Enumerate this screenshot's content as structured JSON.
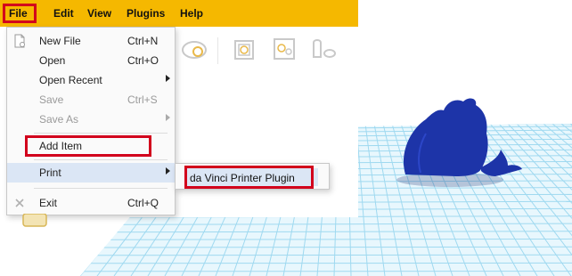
{
  "menubar": {
    "items": [
      {
        "label": "File"
      },
      {
        "label": "Edit"
      },
      {
        "label": "View"
      },
      {
        "label": "Plugins"
      },
      {
        "label": "Help"
      }
    ]
  },
  "file_menu": {
    "items": [
      {
        "label": "New File",
        "shortcut": "Ctrl+N",
        "enabled": true,
        "icon": "new-file-icon"
      },
      {
        "label": "Open",
        "shortcut": "Ctrl+O",
        "enabled": true
      },
      {
        "label": "Open Recent",
        "shortcut": "",
        "enabled": true,
        "submenu": true
      },
      {
        "label": "Save",
        "shortcut": "Ctrl+S",
        "enabled": false
      },
      {
        "label": "Save As",
        "shortcut": "",
        "enabled": false,
        "submenu": true
      },
      {
        "label": "Add Item",
        "shortcut": "",
        "enabled": true
      },
      {
        "label": "Print",
        "shortcut": "",
        "enabled": true,
        "submenu": true,
        "selected": true
      },
      {
        "label": "Exit",
        "shortcut": "Ctrl+Q",
        "enabled": true,
        "icon": "exit-icon"
      }
    ]
  },
  "print_submenu": {
    "items": [
      {
        "label": "da Vinci Printer Plugin"
      }
    ]
  },
  "colors": {
    "menubar": "#f5b800",
    "highlight": "#d2001c",
    "model": "#1d34a8",
    "grid": "#9fd9f0"
  },
  "toolbar": {
    "icons": [
      "rotate-icon",
      "scale-icon",
      "arrange-icon",
      "mirror-icon"
    ]
  }
}
